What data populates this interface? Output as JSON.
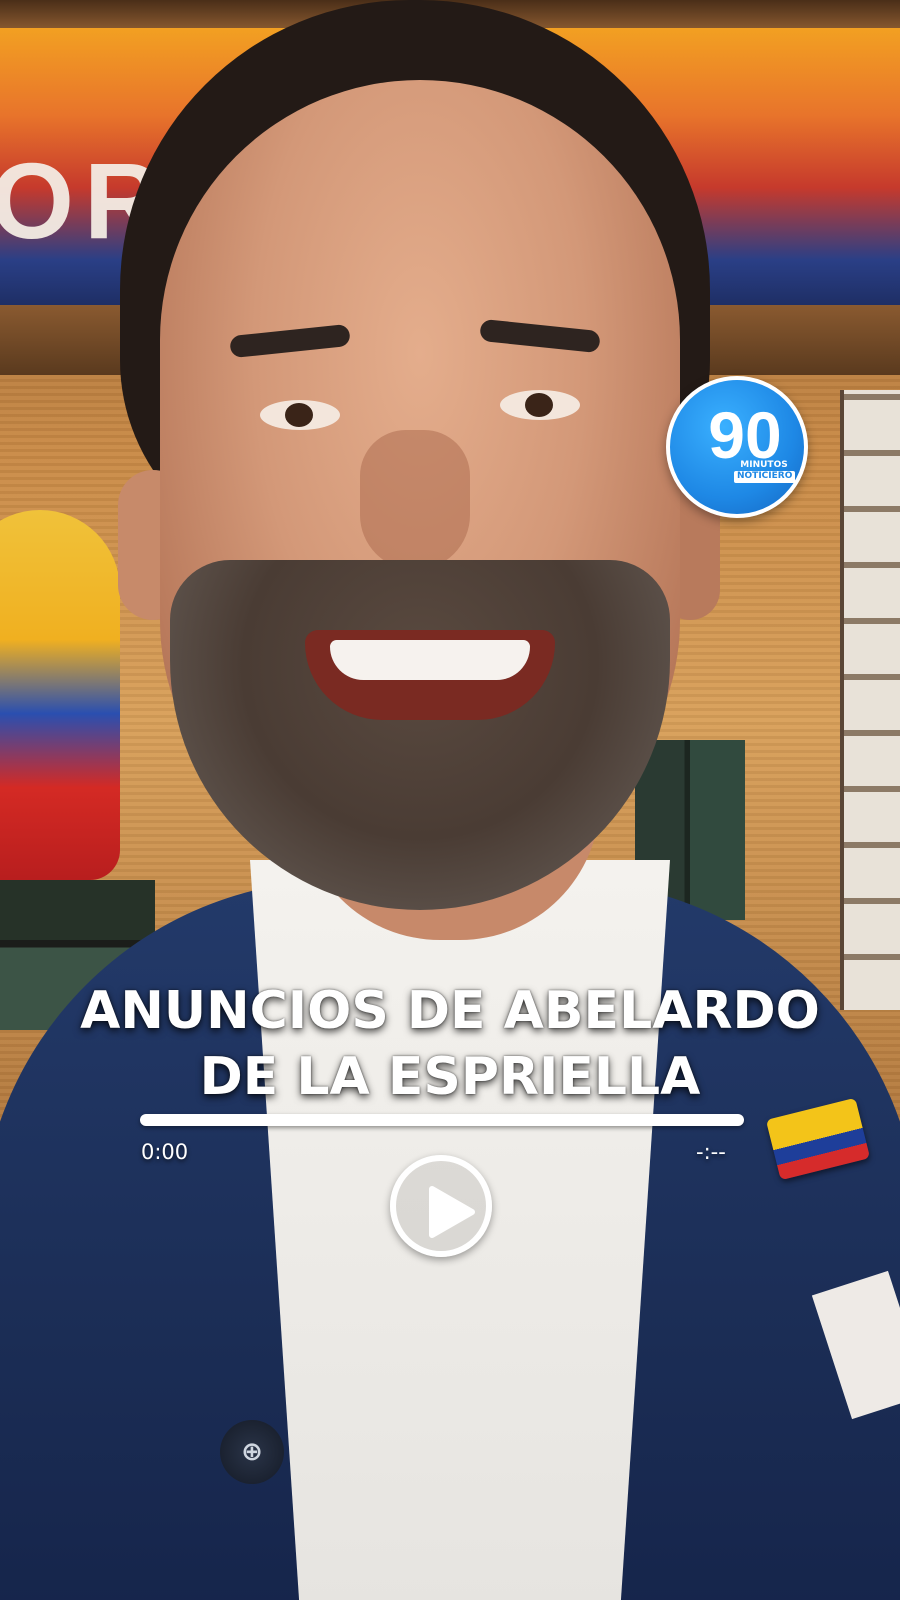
{
  "video": {
    "headline_line1": "ANUNCIOS DE ABELARDO",
    "headline_line2": "DE LA ESPRIELLA",
    "current_time": "0:00",
    "remaining_time": "-:--",
    "progress": 0
  },
  "logo": {
    "number": "90",
    "line1": "MINUTOS",
    "line2": "NOTICIERO",
    "color": "#1e88e5"
  },
  "background": {
    "banner_text": "ORRE   A PA"
  },
  "icons": {
    "play": "play-icon"
  }
}
